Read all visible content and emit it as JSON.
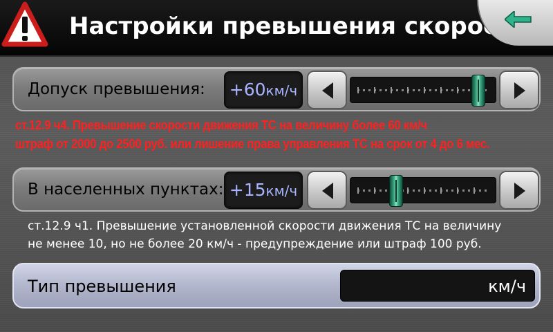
{
  "header": {
    "title": "Настройки превышения скорости",
    "warning_icon": "warning-triangle-icon",
    "back_icon": "arrow-left-icon",
    "colors": {
      "accent_arrow": "#2fb38a",
      "warning_red": "#cc1d1d"
    }
  },
  "tolerance": {
    "label": "Допуск превышения:",
    "value": "+60",
    "unit": "км/ч",
    "slider_fraction": 0.95,
    "law_text_line1": "ст.12.9 ч4. Превышение скорости движения ТС на величину более 60 км/ч",
    "law_text_line2": "штраф от 2000 до 2500 руб. или лишение права управления ТС на срок от 4 до 6 мес."
  },
  "settlements": {
    "label": "В населенных пунктах:",
    "value": "+15",
    "unit": "км/ч",
    "slider_fraction": 0.27,
    "law_text_line1": "ст.12.9 ч1. Превышение установленной скорости движения ТС на величину",
    "law_text_line2": "не менее 10, но не более 20 км/ч - предупреждение или штраф 100 руб."
  },
  "exceed_type": {
    "label": "Тип превышения",
    "value": "км/ч"
  },
  "icons": {
    "decrease": "triangle-left-icon",
    "increase": "triangle-right-icon"
  }
}
